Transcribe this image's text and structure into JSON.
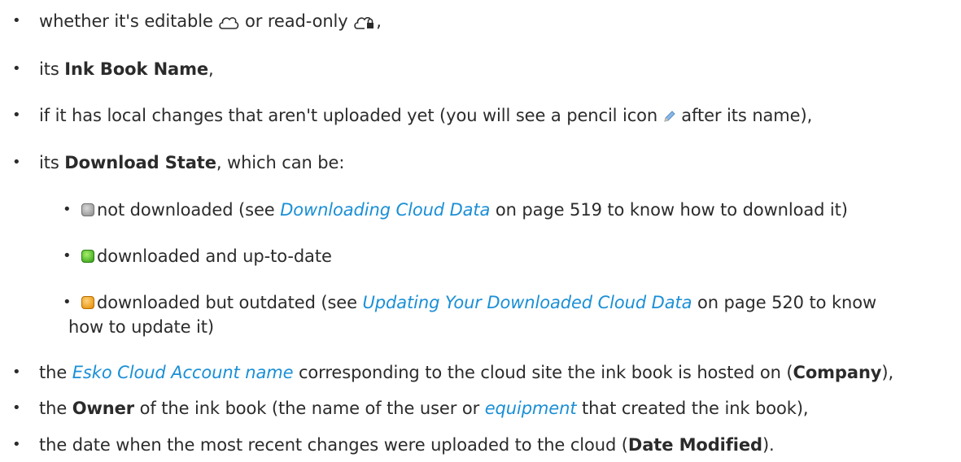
{
  "bullets": {
    "editable": {
      "pre": "whether it's editable ",
      "mid": " or read-only ",
      "post": ","
    },
    "name": {
      "pre": "its ",
      "bold": "Ink Book Name",
      "post": ","
    },
    "local_changes": {
      "pre": "if it has local changes that aren't uploaded yet (you will see a pencil icon ",
      "post": " after its name),"
    },
    "download_state": {
      "pre": "its ",
      "bold": "Download State",
      "post": ", which can be:"
    },
    "state_not_downloaded": {
      "pre": "not downloaded (see ",
      "link": "Downloading Cloud Data",
      "post": " on page 519 to know how to download it)"
    },
    "state_up_to_date": {
      "text": "downloaded and up-to-date"
    },
    "state_outdated": {
      "pre": "downloaded but outdated (see ",
      "link": "Updating Your Downloaded Cloud Data",
      "post": " on page 520 to know",
      "line2": "how to update it)"
    },
    "company": {
      "pre": "the ",
      "link": "Esko Cloud Account name",
      "mid": " corresponding to the cloud site the ink book is hosted on (",
      "bold": "Company",
      "post": "),"
    },
    "owner": {
      "pre": "the ",
      "bold": "Owner",
      "mid": " of the ink book (the name of the user or ",
      "link": "equipment",
      "post": " that created the ink book),"
    },
    "date_modified": {
      "pre": "the date when the most recent changes were uploaded to the cloud (",
      "bold": "Date Modified",
      "post": ")."
    }
  },
  "bullet_glyph": "•",
  "colors": {
    "link": "#1a8fd6",
    "text": "#2b2b2b"
  },
  "icons": [
    "cloud-editable-icon",
    "cloud-readonly-icon",
    "pencil-icon",
    "status-gray-icon",
    "status-green-icon",
    "status-orange-icon"
  ]
}
